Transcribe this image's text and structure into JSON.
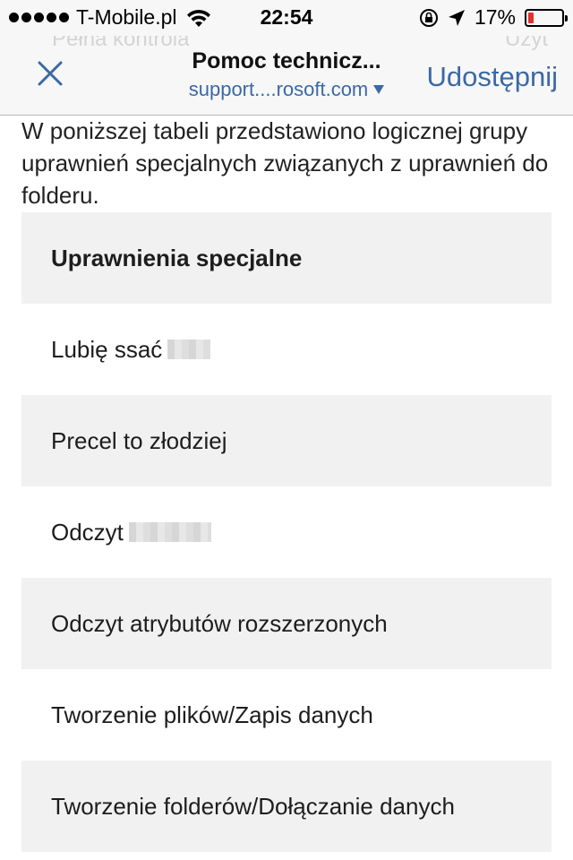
{
  "status_bar": {
    "carrier": "T-Mobile.pl",
    "time": "22:54",
    "battery": "17%",
    "battery_level": 0.17,
    "icons": [
      "signal-dots",
      "wifi-icon",
      "rotation-lock-icon",
      "location-arrow-icon",
      "battery-icon"
    ]
  },
  "nav": {
    "background_left": "Pełna kontrola",
    "background_right": "Użyt",
    "close_icon": "close-icon",
    "title": "Pomoc technicz...",
    "url": "support....rosoft.com",
    "share_label": "Udostępnij",
    "accent_color": "#3b69a5"
  },
  "content": {
    "intro": "W poniższej tabeli przedstawiono logicznej grupy uprawnień specjalnych związanych z uprawnień do folderu.",
    "table": {
      "header": "Uprawnienia specjalne",
      "rows": [
        "Lubię ssać",
        "Precel to złodziej",
        "Odczyt",
        "Odczyt atrybutów rozszerzonych",
        "Tworzenie plików/Zapis danych",
        "Tworzenie folderów/Dołączanie danych"
      ]
    }
  }
}
